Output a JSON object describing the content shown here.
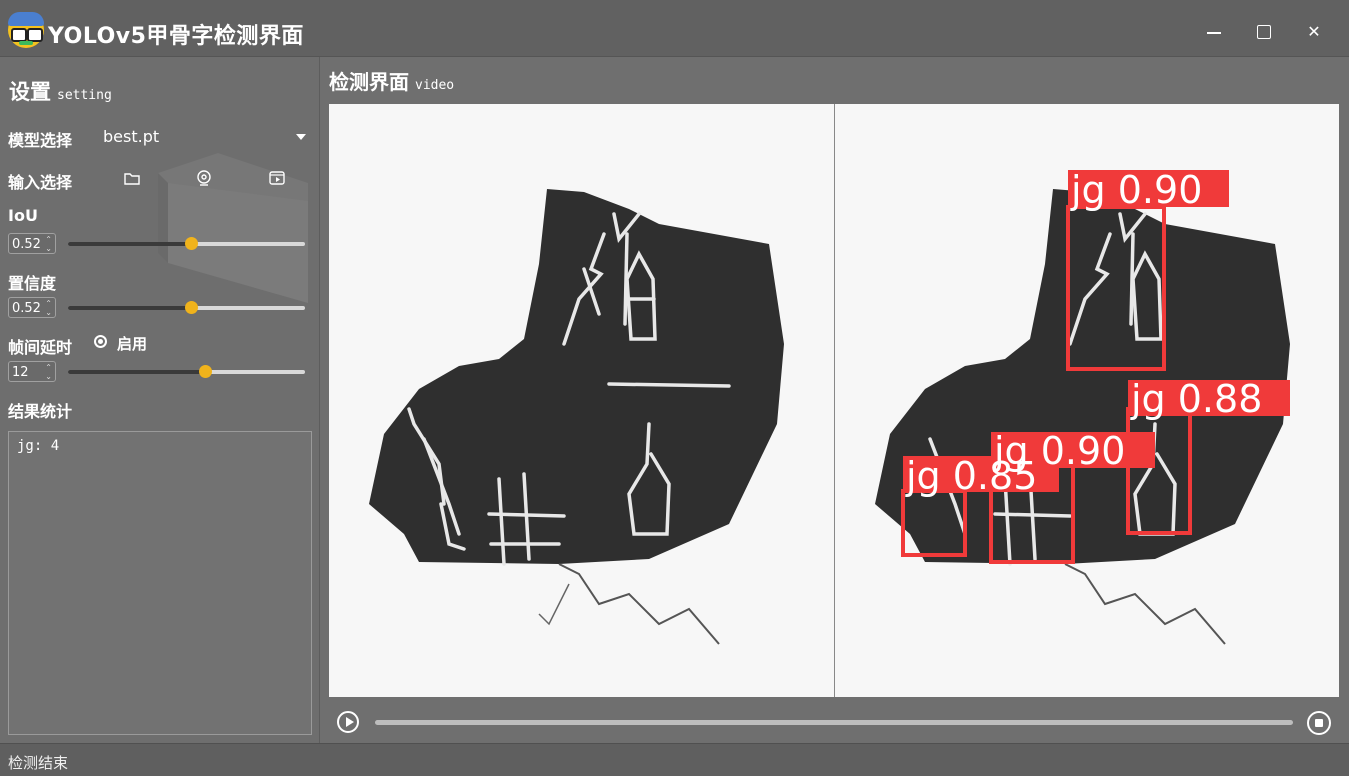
{
  "window": {
    "title": "YOLOv5甲骨字检测界面",
    "minimize_icon": "minimize-icon",
    "maximize_icon": "maximize-icon",
    "close_icon": "close-icon"
  },
  "sidebar": {
    "header": "设置",
    "header_sub": "setting",
    "model_label": "模型选择",
    "model_value": "best.pt",
    "input_label": "输入选择",
    "input_icons": [
      "folder-icon",
      "webcam-icon",
      "video-file-icon"
    ],
    "iou_label": "IoU",
    "iou_value": "0.52",
    "iou_fraction": 0.52,
    "conf_label": "置信度",
    "conf_value": "0.52",
    "conf_fraction": 0.52,
    "delay_label": "帧间延时",
    "delay_enable_label": "启用",
    "delay_enabled": true,
    "delay_value": "12",
    "delay_fraction": 0.58,
    "result_label": "结果统计",
    "result_text": "jg: 4"
  },
  "main": {
    "header": "检测界面",
    "header_sub": "video",
    "detections": [
      {
        "label": "jg",
        "score": "0.90",
        "text": "jg 0.90"
      },
      {
        "label": "jg",
        "score": "0.88",
        "text": "jg 0.88"
      },
      {
        "label": "jg",
        "score": "0.90",
        "text": "jg 0.90"
      },
      {
        "label": "jg",
        "score": "0.85",
        "text": "jg 0.85"
      }
    ],
    "play_icon": "play-icon",
    "stop_icon": "stop-icon",
    "progress_fraction": 0.0
  },
  "status": {
    "text": "检测结束"
  },
  "colors": {
    "accent": "#f0b31c",
    "box": "#f03a3a",
    "bg": "#6f6f6f"
  }
}
